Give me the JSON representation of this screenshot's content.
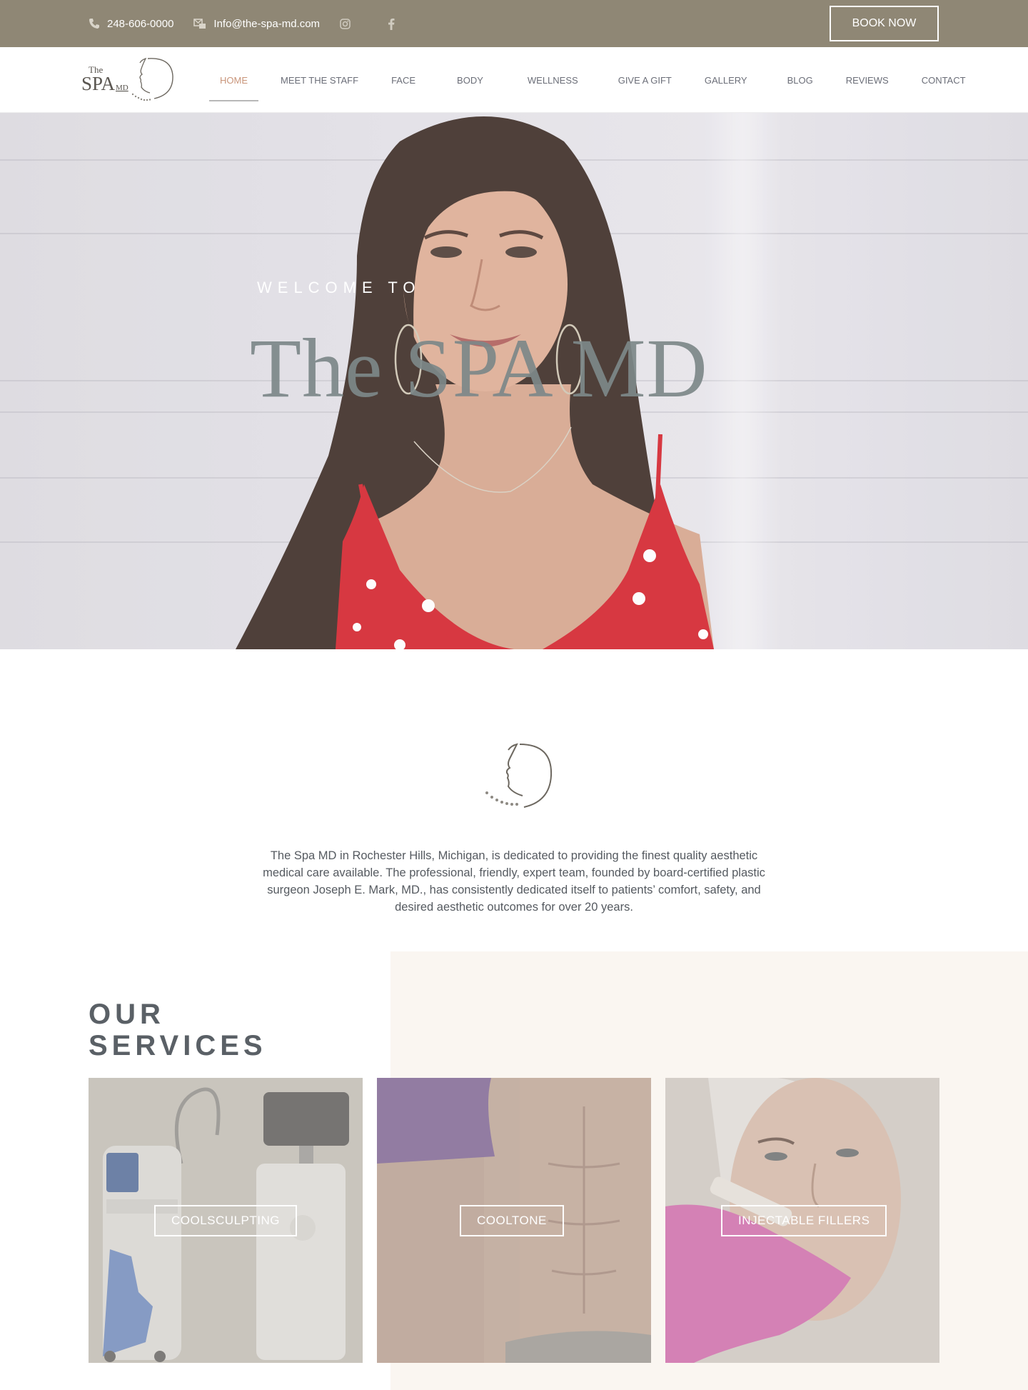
{
  "topbar": {
    "phone": "248-606-0000",
    "email": "Info@the-spa-md.com",
    "social": [
      "instagram-icon",
      "facebook-icon"
    ],
    "book_now": "BOOK NOW"
  },
  "logo": {
    "line1": "The",
    "line2": "SPA",
    "line3": "MD"
  },
  "nav": {
    "items": [
      {
        "label": "HOME",
        "active": true
      },
      {
        "label": "MEET THE STAFF"
      },
      {
        "label": "FACE"
      },
      {
        "label": "BODY"
      },
      {
        "label": "WELLNESS"
      },
      {
        "label": "GIVE A GIFT"
      },
      {
        "label": "GALLERY"
      },
      {
        "label": "BLOG"
      },
      {
        "label": "REVIEWS"
      },
      {
        "label": "CONTACT"
      }
    ]
  },
  "hero": {
    "welcome": "WELCOME TO",
    "title": "The SPA MD"
  },
  "intro": {
    "text": "The Spa MD in Rochester Hills, Michigan, is dedicated to providing the finest quality aesthetic medical care available. The professional, friendly, expert team, founded by board-certified plastic surgeon Joseph E. Mark, MD., has consistently dedicated itself to patients’ comfort, safety, and desired aesthetic outcomes for over 20 years."
  },
  "services": {
    "title_line1": "OUR",
    "title_line2": "SERVICES",
    "cards": [
      {
        "label": "COOLSCULPTING"
      },
      {
        "label": "COOLTONE"
      },
      {
        "label": "INJECTABLE FILLERS"
      }
    ]
  },
  "colors": {
    "topbar": "#8f8775",
    "nav_text": "#6b6e78",
    "nav_active": "#c9957a",
    "hero_title": "#7d8889",
    "services_bg": "#faf6f1"
  }
}
